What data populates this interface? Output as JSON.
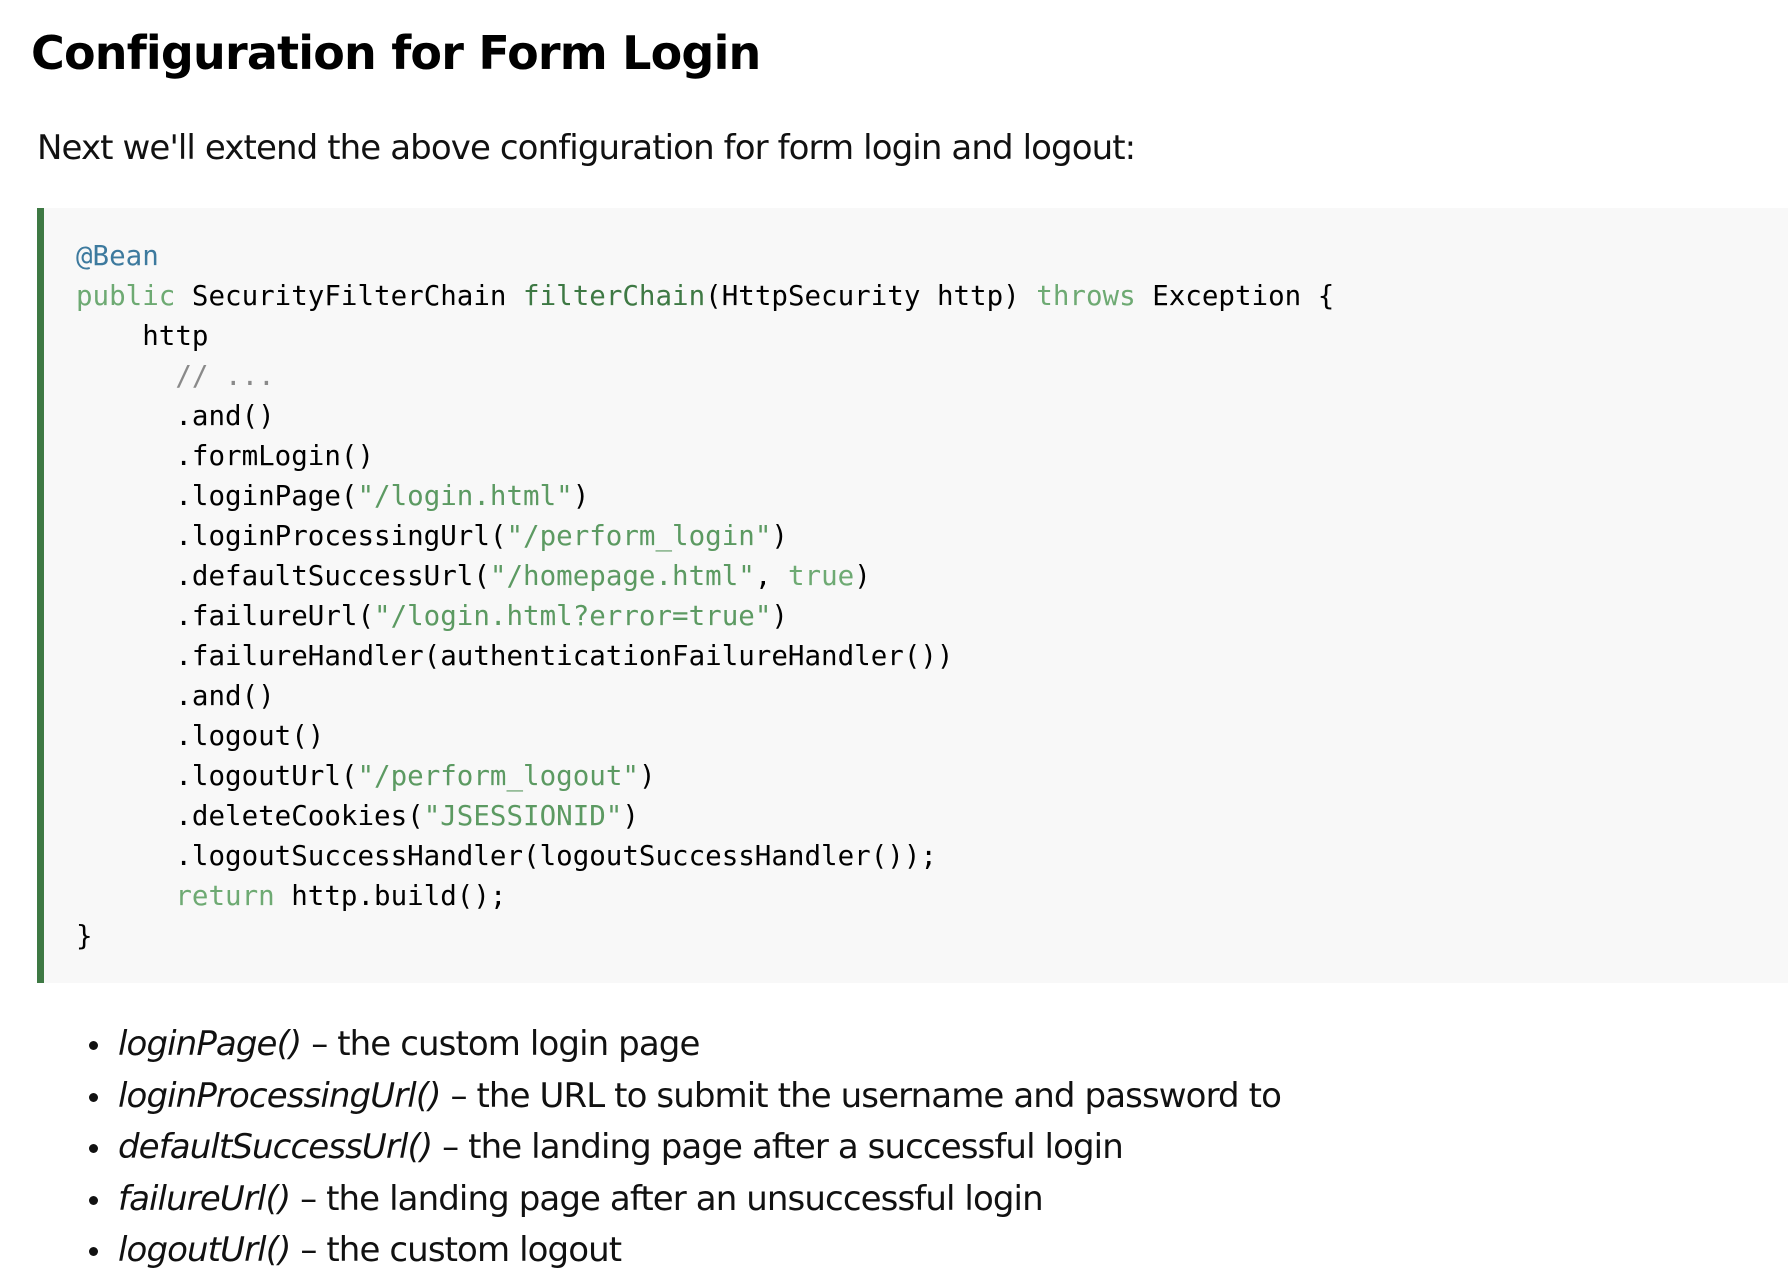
{
  "heading": "Configuration for Form Login",
  "intro": "Next we'll extend the above configuration for form login and logout:",
  "code": {
    "lines": [
      [
        {
          "t": "@Bean",
          "c": "ann"
        }
      ],
      [
        {
          "t": "public",
          "c": "kw"
        },
        {
          "t": " SecurityFilterChain ",
          "c": "plain"
        },
        {
          "t": "filterChain",
          "c": "fn"
        },
        {
          "t": "(HttpSecurity http) ",
          "c": "plain"
        },
        {
          "t": "throws",
          "c": "kw"
        },
        {
          "t": " Exception {",
          "c": "plain"
        }
      ],
      [
        {
          "t": "    http",
          "c": "plain"
        }
      ],
      [
        {
          "t": "      // ...",
          "c": "cmt"
        }
      ],
      [
        {
          "t": "      .and()",
          "c": "plain"
        }
      ],
      [
        {
          "t": "      .formLogin()",
          "c": "plain"
        }
      ],
      [
        {
          "t": "      .loginPage(",
          "c": "plain"
        },
        {
          "t": "\"/login.html\"",
          "c": "str"
        },
        {
          "t": ")",
          "c": "plain"
        }
      ],
      [
        {
          "t": "      .loginProcessingUrl(",
          "c": "plain"
        },
        {
          "t": "\"/perform_login\"",
          "c": "str"
        },
        {
          "t": ")",
          "c": "plain"
        }
      ],
      [
        {
          "t": "      .defaultSuccessUrl(",
          "c": "plain"
        },
        {
          "t": "\"/homepage.html\"",
          "c": "str"
        },
        {
          "t": ", ",
          "c": "plain"
        },
        {
          "t": "true",
          "c": "kw"
        },
        {
          "t": ")",
          "c": "plain"
        }
      ],
      [
        {
          "t": "      .failureUrl(",
          "c": "plain"
        },
        {
          "t": "\"/login.html?error=true\"",
          "c": "str"
        },
        {
          "t": ")",
          "c": "plain"
        }
      ],
      [
        {
          "t": "      .failureHandler(authenticationFailureHandler())",
          "c": "plain"
        }
      ],
      [
        {
          "t": "      .and()",
          "c": "plain"
        }
      ],
      [
        {
          "t": "      .logout()",
          "c": "plain"
        }
      ],
      [
        {
          "t": "      .logoutUrl(",
          "c": "plain"
        },
        {
          "t": "\"/perform_logout\"",
          "c": "str"
        },
        {
          "t": ")",
          "c": "plain"
        }
      ],
      [
        {
          "t": "      .deleteCookies(",
          "c": "plain"
        },
        {
          "t": "\"JSESSIONID\"",
          "c": "str"
        },
        {
          "t": ")",
          "c": "plain"
        }
      ],
      [
        {
          "t": "      .logoutSuccessHandler(logoutSuccessHandler());",
          "c": "plain"
        }
      ],
      [
        {
          "t": "      ",
          "c": "plain"
        },
        {
          "t": "return",
          "c": "kw"
        },
        {
          "t": " http.build();",
          "c": "plain"
        }
      ],
      [
        {
          "t": "}",
          "c": "plain"
        }
      ]
    ]
  },
  "bullets": [
    {
      "method": "loginPage()",
      "desc": " – the custom login page"
    },
    {
      "method": "loginProcessingUrl()",
      "desc": " – the URL to submit the username and password to"
    },
    {
      "method": "defaultSuccessUrl()",
      "desc": " – the landing page after a successful login"
    },
    {
      "method": "failureUrl()",
      "desc": " – the landing page after an unsuccessful login"
    },
    {
      "method": "logoutUrl()",
      "desc": " – the custom logout"
    }
  ]
}
